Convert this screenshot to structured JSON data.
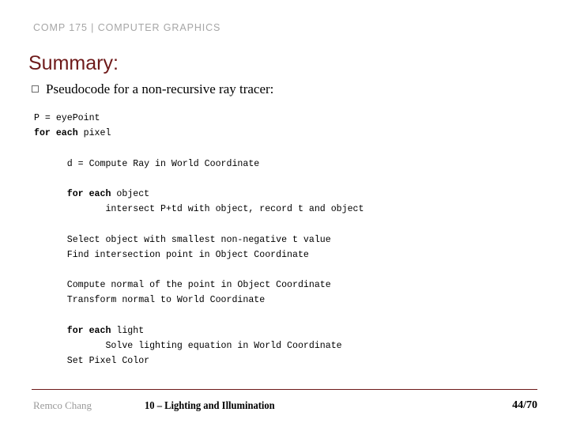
{
  "header": {
    "course": "COMP 175 | COMPUTER GRAPHICS"
  },
  "title": "Summary:",
  "bullet": {
    "marker": "hollow-square",
    "text": "Pseudocode for a non-recursive ray tracer:"
  },
  "code": {
    "lines": [
      {
        "indent": 0,
        "bold": "",
        "rest": "P = eyePoint"
      },
      {
        "indent": 0,
        "bold": "for each",
        "rest": " pixel"
      },
      {
        "indent": 0,
        "bold": "",
        "rest": ""
      },
      {
        "indent": 6,
        "bold": "",
        "rest": "d = Compute Ray in World Coordinate"
      },
      {
        "indent": 0,
        "bold": "",
        "rest": ""
      },
      {
        "indent": 6,
        "bold": "for each",
        "rest": " object"
      },
      {
        "indent": 13,
        "bold": "",
        "rest": "intersect P+td with object, record t and object"
      },
      {
        "indent": 0,
        "bold": "",
        "rest": ""
      },
      {
        "indent": 6,
        "bold": "",
        "rest": "Select object with smallest non-negative t value"
      },
      {
        "indent": 6,
        "bold": "",
        "rest": "Find intersection point in Object Coordinate"
      },
      {
        "indent": 0,
        "bold": "",
        "rest": ""
      },
      {
        "indent": 6,
        "bold": "",
        "rest": "Compute normal of the point in Object Coordinate"
      },
      {
        "indent": 6,
        "bold": "",
        "rest": "Transform normal to World Coordinate"
      },
      {
        "indent": 0,
        "bold": "",
        "rest": ""
      },
      {
        "indent": 6,
        "bold": "for each",
        "rest": " light"
      },
      {
        "indent": 13,
        "bold": "",
        "rest": "Solve lighting equation in World Coordinate"
      },
      {
        "indent": 6,
        "bold": "",
        "rest": "Set Pixel Color"
      }
    ]
  },
  "footer": {
    "author": "Remco Chang",
    "topic": "10 – Lighting and Illumination",
    "page": "44/70"
  },
  "colors": {
    "accent": "#6e1a1a",
    "eyebrow": "#a6a6a6",
    "body": "#000000",
    "footer_author": "#9a9a9a"
  }
}
